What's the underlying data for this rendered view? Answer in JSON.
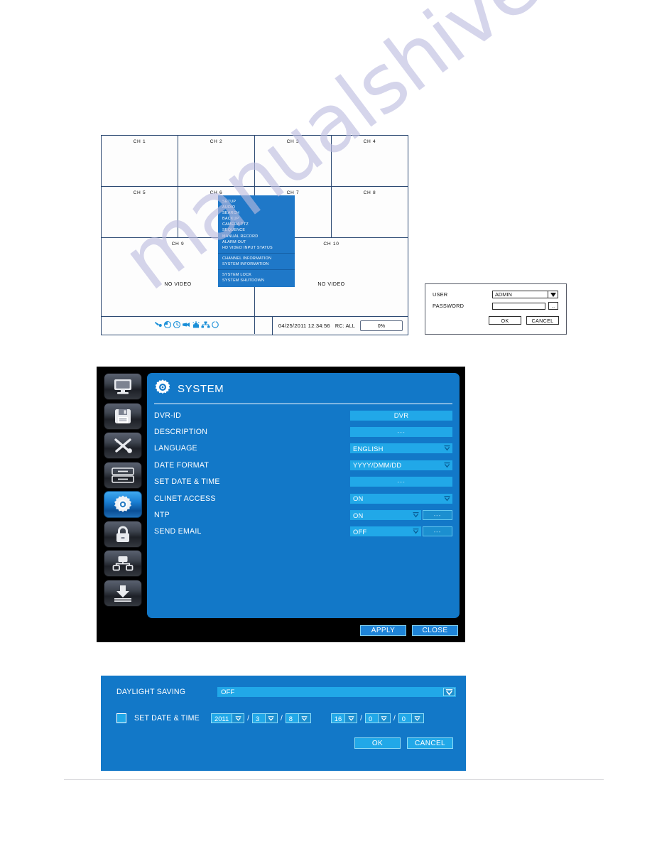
{
  "watermark": {
    "text": "manualshive.com"
  },
  "live_view": {
    "cells_row1": [
      {
        "label": "CH 1"
      },
      {
        "label": "CH 2"
      },
      {
        "label": "CH 3"
      },
      {
        "label": "CH 4"
      }
    ],
    "cells_row2": [
      {
        "label": "CH 5"
      },
      {
        "label": "CH 6"
      },
      {
        "label": "CH 7"
      },
      {
        "label": "CH 8"
      }
    ],
    "cells_row3": [
      {
        "label": "CH 9",
        "novideo": "NO VIDEO"
      },
      {
        "label": "CH 10",
        "novideo": "NO VIDEO"
      }
    ],
    "status": {
      "icons": [
        "ptz-icon",
        "clock-half-icon",
        "clock-icon",
        "camera-record-icon",
        "alarm-icon",
        "network-icon",
        "sequence-icon"
      ],
      "datetime": "04/25/2011 12:34:56",
      "remote_control": "RC: ALL",
      "hdd_usage": "0%"
    }
  },
  "context_menu": {
    "groups": [
      {
        "items": [
          "SETUP",
          "AUDIO",
          "SEARCH",
          "BACKUP",
          "CAMERA PTZ",
          "SEQUENCE",
          "MANUAL RECORD",
          "ALARM OUT",
          "HD VIDEO INPUT STATUS"
        ]
      },
      {
        "items": [
          "CHANNEL INFORMATION",
          "SYSTEM INFORMATION"
        ]
      },
      {
        "items": [
          "SYSTEM LOCK",
          "SYSTEM SHUTDOWN"
        ]
      }
    ]
  },
  "login": {
    "user_label": "USER",
    "user_value": "ADMIN",
    "password_label": "PASSWORD",
    "password_value": "",
    "password_browse": "...",
    "ok_label": "OK",
    "cancel_label": "CANCEL"
  },
  "system_window": {
    "title": "SYSTEM",
    "sidebar": [
      {
        "icon": "display-icon",
        "active": false
      },
      {
        "icon": "save-icon",
        "active": false
      },
      {
        "icon": "tools-icon",
        "active": false
      },
      {
        "icon": "storage-icon",
        "active": false
      },
      {
        "icon": "system-gear-icon",
        "active": true
      },
      {
        "icon": "lock-icon",
        "active": false
      },
      {
        "icon": "network-icon",
        "active": false
      },
      {
        "icon": "backup-download-icon",
        "active": false
      }
    ],
    "rows": [
      {
        "label": "DVR-ID",
        "value": "DVR",
        "style": "center",
        "caret": false,
        "extra": null
      },
      {
        "label": "DESCRIPTION",
        "value": "---",
        "style": "dash",
        "caret": false,
        "extra": null
      },
      {
        "label": "LANGUAGE",
        "value": "ENGLISH",
        "style": "left",
        "caret": true,
        "extra": null
      },
      {
        "label": "DATE FORMAT",
        "value": "YYYY/DMM/DD",
        "style": "left",
        "caret": true,
        "extra": null
      },
      {
        "label": "SET DATE & TIME",
        "value": "---",
        "style": "dash",
        "caret": false,
        "extra": null
      },
      {
        "label": "CLINET ACCESS",
        "value": "ON",
        "style": "left",
        "caret": true,
        "extra": null
      },
      {
        "label": "NTP",
        "value": "ON",
        "style": "left",
        "caret": true,
        "extra": "---"
      },
      {
        "label": "SEND EMAIL",
        "value": "OFF",
        "style": "left",
        "caret": true,
        "extra": "---"
      }
    ],
    "apply_label": "APPLY",
    "close_label": "CLOSE"
  },
  "daylight_saving": {
    "label": "DAYLIGHT SAVING",
    "value": "OFF",
    "set_datetime_label": "SET DATE & TIME",
    "checkbox_checked": false,
    "date": {
      "year": "2011",
      "month": "3",
      "day": "8"
    },
    "time": {
      "hour": "16",
      "minute": "0",
      "second": "0"
    },
    "date_sep": "/",
    "ok_label": "OK",
    "cancel_label": "CANCEL"
  },
  "colors": {
    "panel_blue": "#1278c8",
    "field_blue": "#21a8e8",
    "menu_blue": "#1f78c8",
    "frame_navy": "#2d4a73",
    "window_black": "#000000",
    "watermark": "#bcbcdf"
  }
}
